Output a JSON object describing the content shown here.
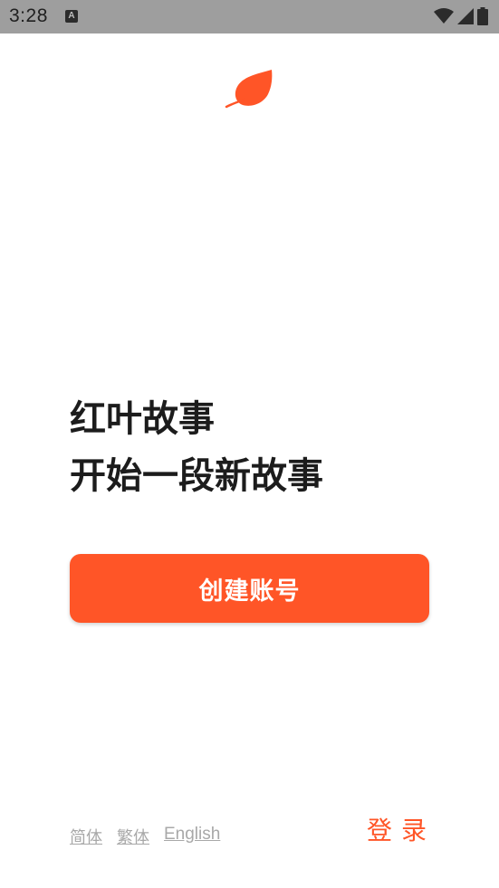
{
  "status_bar": {
    "time": "3:28",
    "notification_icon": "A",
    "icons": [
      "wifi-icon",
      "signal-icon",
      "battery-icon"
    ]
  },
  "logo": {
    "icon": "leaf-icon",
    "color": "#ff5527"
  },
  "headline": {
    "line1": "红叶故事",
    "line2": "开始一段新故事"
  },
  "create_account_button": {
    "label": "创建账号",
    "color": "#ff5527"
  },
  "languages": {
    "simplified": "简体",
    "traditional": "繁体",
    "english": "English"
  },
  "login": {
    "label": "登录"
  },
  "colors": {
    "accent": "#ff5527",
    "status_bar": "#9e9e9e",
    "text": "#1c1c1c",
    "muted": "#a8a8a8"
  }
}
